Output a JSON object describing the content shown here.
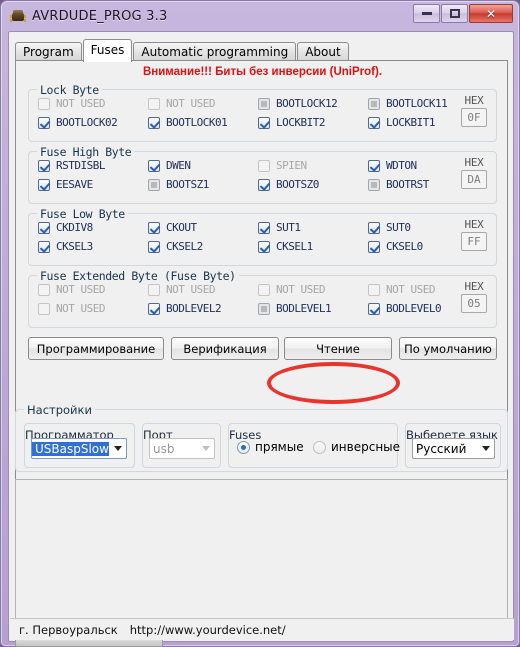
{
  "window": {
    "title": "AVRDUDE_PROG 3.3",
    "icon": "chip-icon",
    "minimize_label": "—",
    "maximize_label": "□",
    "close_label": "✕"
  },
  "tabs": [
    {
      "label": "Program",
      "active": false
    },
    {
      "label": "Fuses",
      "active": true
    },
    {
      "label": "Automatic programming",
      "active": false
    },
    {
      "label": "About",
      "active": false
    }
  ],
  "warning": "Внимание!!! Биты без инверсии (UniProf).",
  "hex_label": "HEX",
  "fuse_groups": [
    {
      "title": "Lock Byte",
      "hex": "0F",
      "row1": [
        {
          "label": "NOT USED",
          "state": "disabled"
        },
        {
          "label": "NOT USED",
          "state": "disabled"
        },
        {
          "label": "BOOTLOCK12",
          "state": "unchecked"
        },
        {
          "label": "BOOTLOCK11",
          "state": "unchecked"
        }
      ],
      "row2": [
        {
          "label": "BOOTLOCK02",
          "state": "checked"
        },
        {
          "label": "BOOTLOCK01",
          "state": "checked"
        },
        {
          "label": "LOCKBIT2",
          "state": "checked"
        },
        {
          "label": "LOCKBIT1",
          "state": "checked"
        }
      ]
    },
    {
      "title": "Fuse High Byte",
      "hex": "DA",
      "row1": [
        {
          "label": "RSTDISBL",
          "state": "checked"
        },
        {
          "label": "DWEN",
          "state": "checked"
        },
        {
          "label": "SPIEN",
          "state": "disabled"
        },
        {
          "label": "WDTON",
          "state": "checked"
        }
      ],
      "row2": [
        {
          "label": "EESAVE",
          "state": "checked"
        },
        {
          "label": "BOOTSZ1",
          "state": "unchecked"
        },
        {
          "label": "BOOTSZ0",
          "state": "checked"
        },
        {
          "label": "BOOTRST",
          "state": "unchecked"
        }
      ]
    },
    {
      "title": "Fuse Low Byte",
      "hex": "FF",
      "row1": [
        {
          "label": "CKDIV8",
          "state": "checked"
        },
        {
          "label": "CKOUT",
          "state": "checked"
        },
        {
          "label": "SUT1",
          "state": "checked"
        },
        {
          "label": "SUT0",
          "state": "checked"
        }
      ],
      "row2": [
        {
          "label": "CKSEL3",
          "state": "checked"
        },
        {
          "label": "CKSEL2",
          "state": "checked"
        },
        {
          "label": "CKSEL1",
          "state": "checked"
        },
        {
          "label": "CKSEL0",
          "state": "checked"
        }
      ]
    },
    {
      "title": "Fuse Extended Byte (Fuse Byte)",
      "hex": "05",
      "row1": [
        {
          "label": "NOT USED",
          "state": "disabled"
        },
        {
          "label": "NOT USED",
          "state": "disabled"
        },
        {
          "label": "NOT USED",
          "state": "disabled"
        },
        {
          "label": "NOT USED",
          "state": "disabled"
        }
      ],
      "row2": [
        {
          "label": "NOT USED",
          "state": "disabled"
        },
        {
          "label": "BODLEVEL2",
          "state": "checked"
        },
        {
          "label": "BODLEVEL1",
          "state": "unchecked"
        },
        {
          "label": "BODLEVEL0",
          "state": "checked"
        }
      ]
    }
  ],
  "action_buttons": [
    {
      "label": "Программирование",
      "highlighted": false
    },
    {
      "label": "Верификация",
      "highlighted": false
    },
    {
      "label": "Чтение",
      "highlighted": true
    },
    {
      "label": "По умолчанию",
      "highlighted": false
    }
  ],
  "settings": {
    "title": "Настройки",
    "programmer": {
      "label": "Программатор",
      "value": "USBaspSlow"
    },
    "port": {
      "label": "Порт",
      "value": "usb"
    },
    "fuses": {
      "label": "Fuses",
      "option_direct": "прямые",
      "option_inverse": "инверсные",
      "selected": "прямые"
    },
    "language": {
      "label": "Выберете язык",
      "value": "Русский"
    }
  },
  "log": {
    "text": ""
  },
  "statusbar": {
    "city": "г. Первоуральск",
    "url": "http://www.yourdevice.net/"
  },
  "annotation": {
    "shape": "red-ellipse",
    "color": "#e8342c",
    "targets": "Чтение"
  }
}
